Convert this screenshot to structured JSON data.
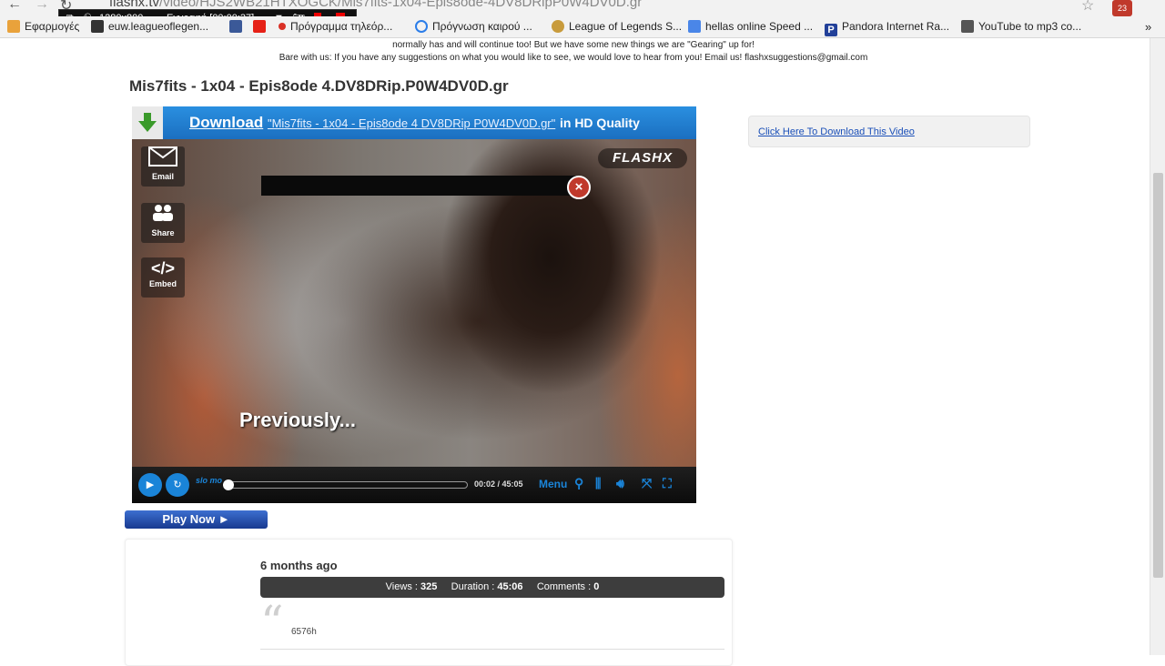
{
  "browser": {
    "url_host": "flashx.tv",
    "url_path": "/video/HJS2WB21HTXOGCK/Mis7fits-1x04-Epis8ode-4DV8DRipP0W4DV0D.gr",
    "bookmarks": [
      {
        "label": "Εφαρμογές",
        "icon_color": "#e9a23b",
        "icon": "apps-icon"
      },
      {
        "label": "euw.leagueoflegen...",
        "icon_color": "#333333",
        "icon": "lol-icon"
      },
      {
        "label": "",
        "icon_color": "#3b5998",
        "icon": "facebook-icon"
      },
      {
        "label": "",
        "icon_color": "#e62117",
        "icon": "youtube-icon"
      },
      {
        "label": "Πρόγραμμα τηλεόρ...",
        "icon_color": "#d93025",
        "icon": "tv-icon"
      },
      {
        "label": "Πρόγνωση καιρού ...",
        "icon_color": "#2b7de9",
        "icon": "weather-icon"
      },
      {
        "label": "League of Legends S...",
        "icon_color": "#c89b3c",
        "icon": "lol-icon"
      },
      {
        "label": "hellas online Speed ...",
        "icon_color": "#4a86e8",
        "icon": "speed-icon"
      },
      {
        "label": "Pandora Internet Ra...",
        "icon_color": "#224099",
        "icon": "pandora-icon"
      },
      {
        "label": "YouTube to mp3 co...",
        "icon_color": "#555555",
        "icon": "convert-icon"
      }
    ],
    "profile_badge": "23",
    "more_glyph": "»"
  },
  "recorder": {
    "resolution": "1280x800",
    "status": "Εγγραφή [00:00:37]"
  },
  "page": {
    "intro_line1": "normally has and will continue too! But we have some new things we are \"Gearing\" up for!",
    "intro_line2": "Bare with us: If you have any suggestions on what you would like to see, we would love to hear from you! Email us! flashxsuggestions@gmail.com",
    "title": "Mis7fits - 1x04 - Epis8ode 4.DV8DRip.P0W4DV0D.gr"
  },
  "player": {
    "download_label": "Download",
    "download_file": "\"Mis7fits - 1x04 - Epis8ode 4 DV8DRip P0W4DV0D.gr\"",
    "download_tail": "in HD Quality",
    "logo": "FLASHX",
    "side_buttons": [
      {
        "label": "Email",
        "glyph": "✉",
        "icon": "email-icon"
      },
      {
        "label": "Share",
        "glyph": "👥",
        "icon": "share-icon"
      },
      {
        "label": "Embed",
        "glyph": "</>",
        "icon": "embed-icon"
      }
    ],
    "caption": "Previously...",
    "time": "00:02 / 45:05",
    "progress": 0.01,
    "slomo_label": "slo mo",
    "menu_label": "Menu",
    "accent": "#1a84d8"
  },
  "play_now": "Play Now ►",
  "side_link": "Click Here To Download This Video",
  "info": {
    "date": "6 months ago",
    "views_label": "Views :",
    "views": "325",
    "duration_label": "Duration :",
    "duration": "45:06",
    "comments_label": "Comments :",
    "comments": "0",
    "description": "6576h"
  }
}
